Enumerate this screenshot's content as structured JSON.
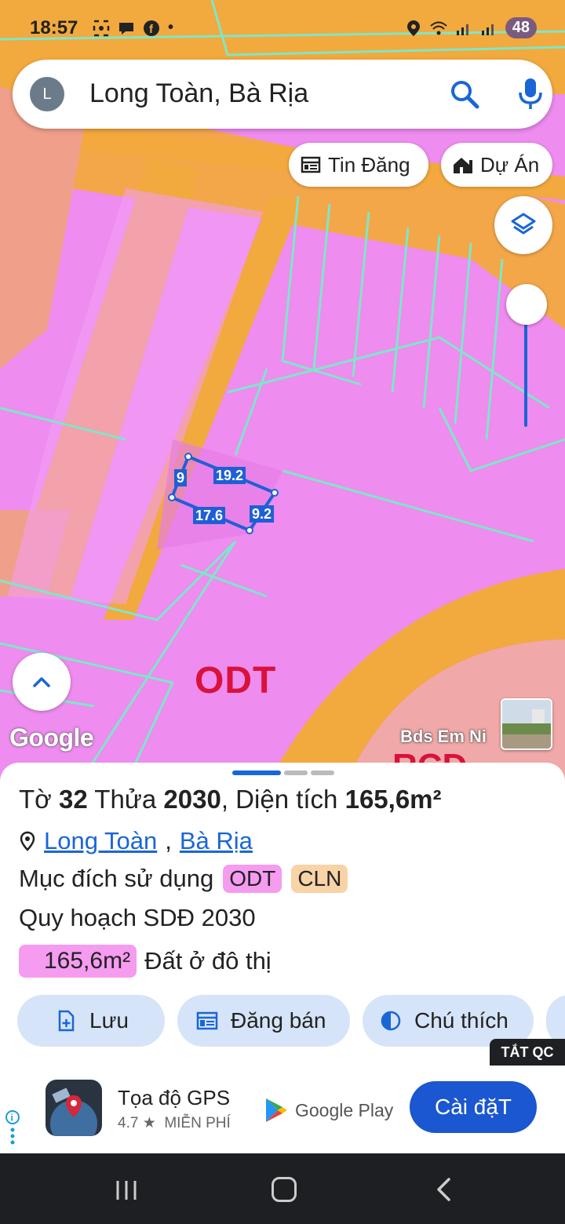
{
  "status_bar": {
    "time": "18:57",
    "battery": "48"
  },
  "search": {
    "avatar_letter": "L",
    "query": "Long Toàn, Bà Rịa"
  },
  "chips": {
    "tin_dang": "Tin Đăng",
    "du_an": "Dự Án"
  },
  "map": {
    "dimensions": [
      "9",
      "19.2",
      "17.6",
      "9.2"
    ],
    "zone_label": "ODT",
    "zone_label_partial": "RCD",
    "google_logo": "Google",
    "watermark": "Bds Em Ni",
    "colors": {
      "residential": "#ee8cf0",
      "road": "#f2a93e",
      "boundary": "#7fe6c8",
      "selection": "#1f5fd6",
      "commercial": "#f0a8a8"
    }
  },
  "parcel": {
    "sheet_label": "Tờ",
    "sheet_no": "32",
    "lot_label": "Thửa",
    "lot_no": "2030",
    "area_label": ", Diện tích",
    "area": "165,6m²",
    "ward": "Long Toàn",
    "city": "Bà Rịa",
    "purpose_label": "Mục đích sử dụng",
    "purpose_codes": [
      "ODT",
      "CLN"
    ],
    "plan_label": "Quy hoạch SDĐ 2030",
    "plan_area": "165,6m²",
    "plan_use": "Đất ở đô thị"
  },
  "actions": {
    "save": "Lưu",
    "post": "Đăng bán",
    "legend": "Chú thích"
  },
  "ad": {
    "close_label": "TẮT QC",
    "app_name": "Tọa độ GPS",
    "rating": "4.7",
    "price": "MIỄN PHÍ",
    "store": "Google Play",
    "install": "Cài đặT"
  }
}
